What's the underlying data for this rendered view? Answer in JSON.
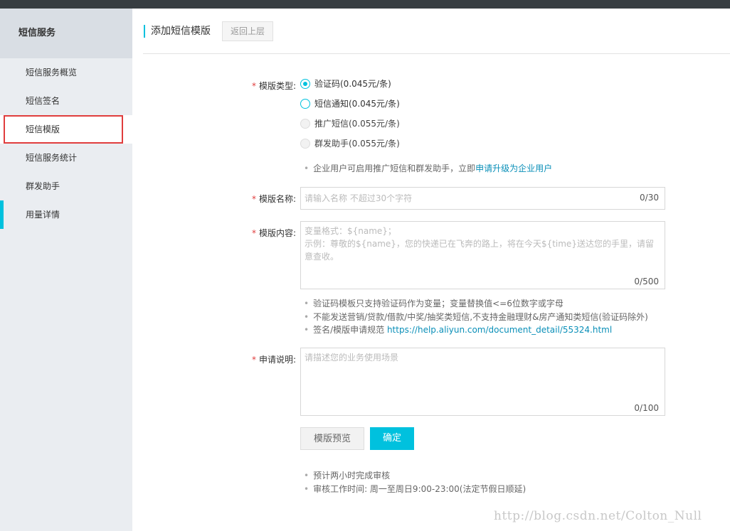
{
  "sidebar": {
    "title": "短信服务",
    "items": [
      {
        "label": "短信服务概览"
      },
      {
        "label": "短信签名"
      },
      {
        "label": "短信模版"
      },
      {
        "label": "短信服务统计"
      },
      {
        "label": "群发助手"
      },
      {
        "label": "用量详情"
      }
    ],
    "active_index": 2
  },
  "header": {
    "title": "添加短信模版",
    "back_label": "返回上层"
  },
  "form": {
    "type_label": "模版类型:",
    "type_options": [
      {
        "label": "验证码(0.045元/条)",
        "state": "checked"
      },
      {
        "label": "短信通知(0.045元/条)",
        "state": "enabled"
      },
      {
        "label": "推广短信(0.055元/条)",
        "state": "disabled"
      },
      {
        "label": "群发助手(0.055元/条)",
        "state": "disabled"
      }
    ],
    "type_hint_text": "企业用户可启用推广短信和群发助手，立即",
    "type_hint_link": "申请升级为企业用户",
    "name_label": "模版名称:",
    "name_placeholder": "请输入名称 不超过30个字符",
    "name_counter": "0/30",
    "content_label": "模版内容:",
    "content_placeholder": "变量格式：${name}；\n示例：尊敬的${name}，您的快递已在飞奔的路上，将在今天${time}送达您的手里，请留意查收。",
    "content_counter": "0/500",
    "content_hints": [
      "验证码模板只支持验证码作为变量；变量替换值<=6位数字或字母",
      "不能发送营销/贷款/借款/中奖/抽奖类短信,不支持金融理财&房产通知类短信(验证码除外)"
    ],
    "spec_hint_text": "签名/模版申请规范",
    "spec_hint_link": "https://help.aliyun.com/document_detail/55324.html",
    "desc_label": "申请说明:",
    "desc_placeholder": "请描述您的业务使用场景",
    "desc_counter": "0/100",
    "preview_label": "模版预览",
    "confirm_label": "确定",
    "review_notes": [
      "预计两小时完成审核",
      "审核工作时间: 周一至周日9:00-23:00(法定节假日顺延)"
    ]
  },
  "watermark": "http://blog.csdn.net/Colton_Null",
  "colors": {
    "accent": "#00c1de",
    "required_star": "#e03d3d",
    "link": "#0a8fb8",
    "highlight_border": "#e03d3d"
  }
}
